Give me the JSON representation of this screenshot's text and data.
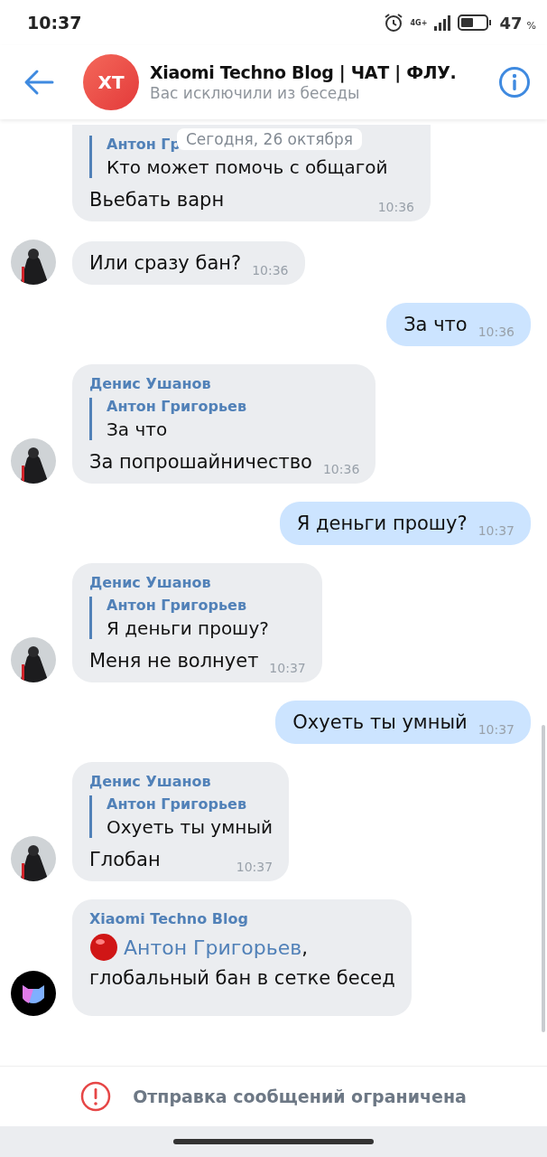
{
  "status_bar": {
    "time": "10:37",
    "network": "4G+",
    "battery": "47",
    "battery_unit": "%"
  },
  "header": {
    "avatar_initials": "XT",
    "title": "Xiaomi Techno Blog | ЧАТ | ФЛУ.",
    "subtitle": "Вас исключили из беседы"
  },
  "date_pill": "Сегодня, 26 октября",
  "messages": [
    {
      "kind": "in",
      "avatar": false,
      "reply": {
        "author": "Антон Гр",
        "text": "Кто может помочь с общагой"
      },
      "text": "Вьебать варн",
      "time": "10:36"
    },
    {
      "kind": "in",
      "avatar": true,
      "text": "Или сразу бан?",
      "time": "10:36"
    },
    {
      "kind": "out",
      "text": "За что",
      "time": "10:36"
    },
    {
      "kind": "in",
      "avatar": true,
      "sender": "Денис Ушанов",
      "reply": {
        "author": "Антон Григорьев",
        "text": "За что"
      },
      "text": "За попрошайничество",
      "time": "10:36"
    },
    {
      "kind": "out",
      "text": "Я деньги прошу?",
      "time": "10:37"
    },
    {
      "kind": "in",
      "avatar": true,
      "sender": "Денис Ушанов",
      "reply": {
        "author": "Антон Григорьев",
        "text": "Я деньги прошу?"
      },
      "text": "Меня не волнует",
      "time": "10:37"
    },
    {
      "kind": "out",
      "text": "Охуеть ты умный",
      "time": "10:37"
    },
    {
      "kind": "in",
      "avatar": true,
      "sender": "Денис Ушанов",
      "reply": {
        "author": "Антон Григорьев",
        "text": "Охуеть ты умный"
      },
      "text": "Глобан",
      "time": "10:37"
    },
    {
      "kind": "bot",
      "avatar": true,
      "sender": "Xiaomi Techno Blog",
      "mention": "Антон Григорьев",
      "after_mention": ",",
      "text": "глобальный бан в сетке бесед"
    }
  ],
  "notice": "Отправка сообщений ограничена"
}
